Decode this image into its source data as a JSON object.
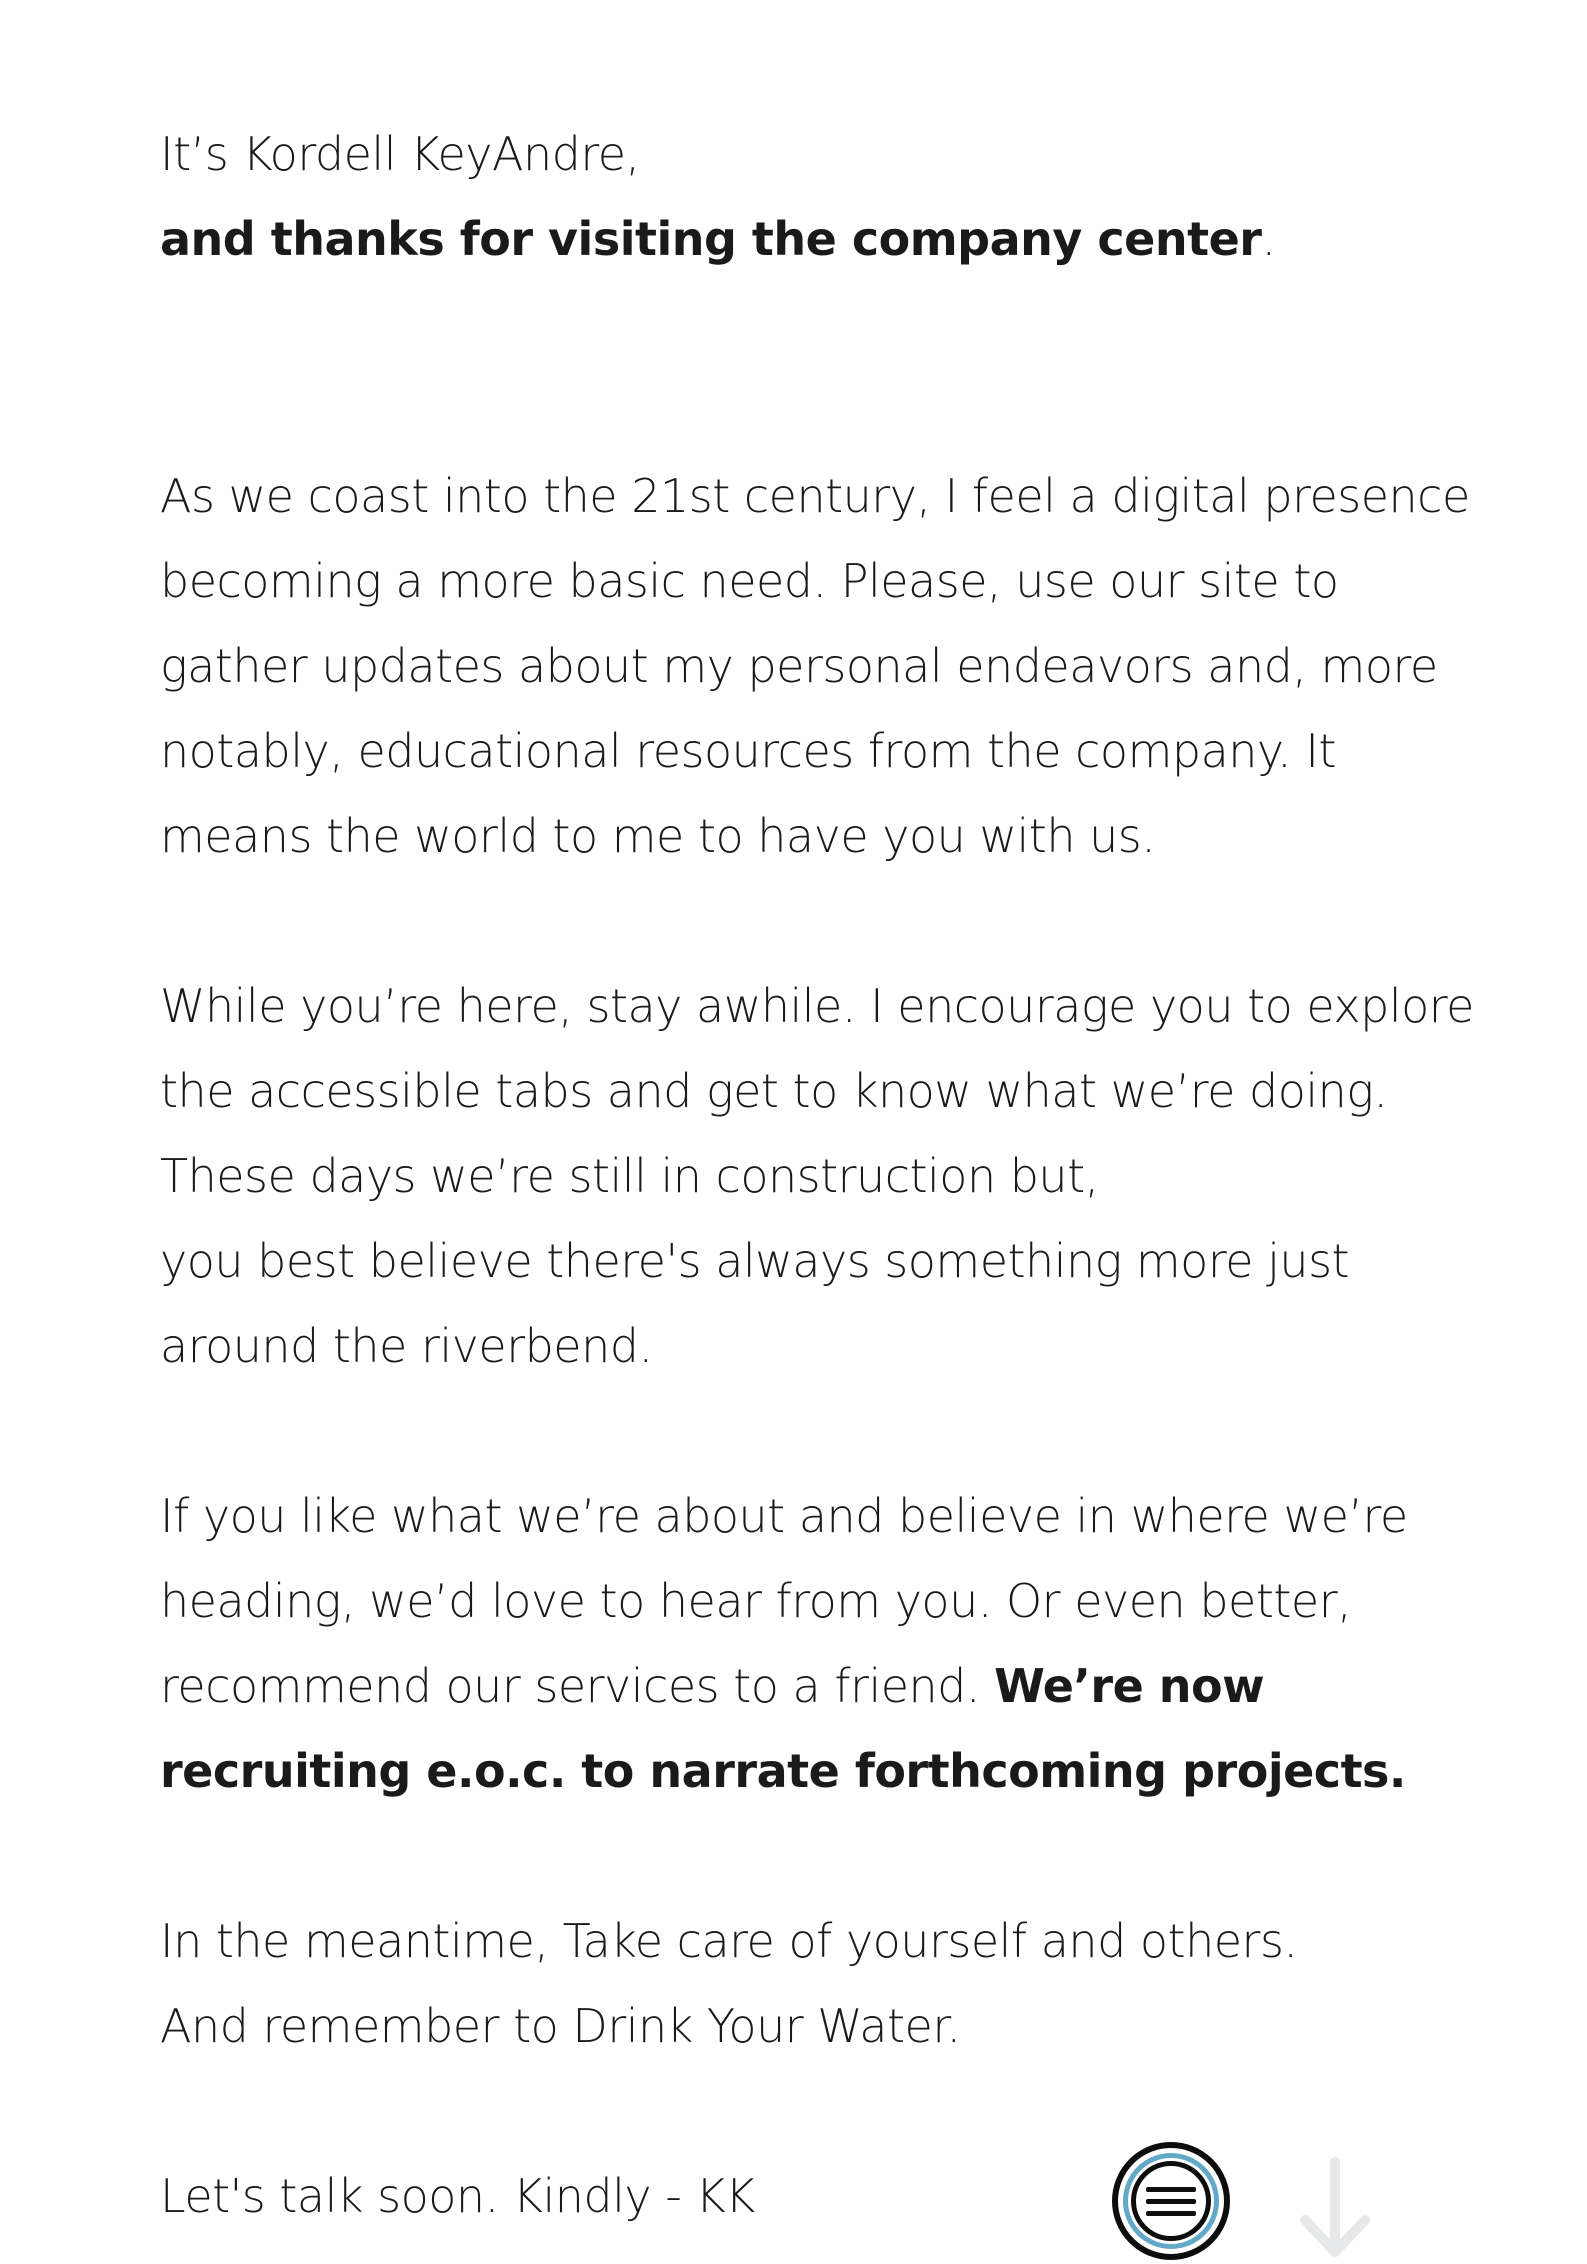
{
  "greeting": {
    "line1": "It’s Kordell KeyAndre,",
    "line2_bold": "and thanks for visiting the company center",
    "line2_tail": "."
  },
  "paragraph1": [
    "As we coast into the 21st century, I feel a digital presence",
    "becoming a more basic need. Please, use our site to",
    "gather updates about my personal endeavors and, more",
    "notably, educational resources from the company. It",
    "means the world to me to have you with us."
  ],
  "paragraph2": [
    "While you’re here, stay awhile. I encourage you to explore",
    "the accessible tabs and get to know what we’re doing.",
    "These days we’re still in construction but,",
    "you best believe there's always something more just",
    "around the riverbend."
  ],
  "paragraph3": {
    "line1": "If you like what we’re about and believe in where we’re",
    "line2": "heading, we’d love to hear from you. Or even better,",
    "line3_regular": "recommend our services to a friend. ",
    "line3_bold": "We’re now",
    "line4_bold": "recruiting e.o.c. to narrate forthcoming projects."
  },
  "paragraph4": [
    "In the meantime, Take care of yourself and others.",
    "And remember to Drink Your Water."
  ],
  "signoff": "Let's talk soon. Kindly - KK",
  "controls": {
    "menu_icon": "hamburger-menu-icon",
    "scroll_icon": "arrow-down-icon",
    "accent_color": "#62a8c7",
    "scroll_arrow_color": "#e6e8ea"
  }
}
